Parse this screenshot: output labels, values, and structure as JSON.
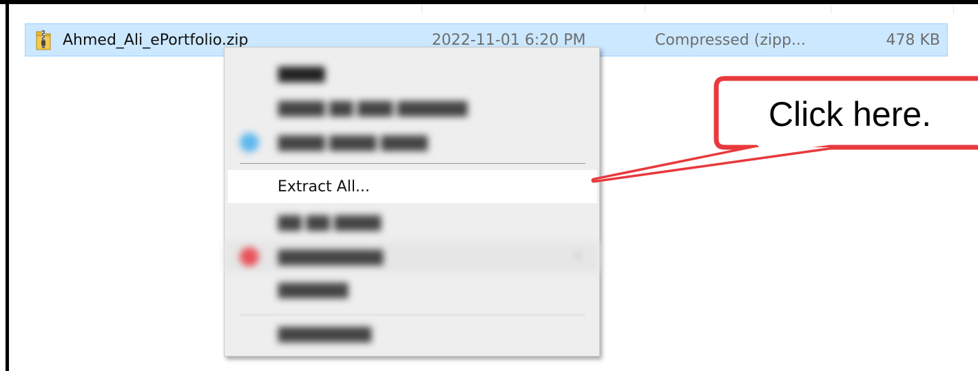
{
  "file": {
    "name": "Ahmed_Ali_ePortfolio.zip",
    "date": "2022-11-01 6:20 PM",
    "type": "Compressed (zipp...",
    "size": "478 KB",
    "icon": "zip-folder-icon"
  },
  "context_menu": {
    "highlighted_item": "Extract All..."
  },
  "callout": {
    "text": "Click here.",
    "color": "#e8393d"
  },
  "colors": {
    "selection_fill": "#cce8ff",
    "selection_border": "#99d1ff",
    "menu_background": "#eeeeee"
  }
}
